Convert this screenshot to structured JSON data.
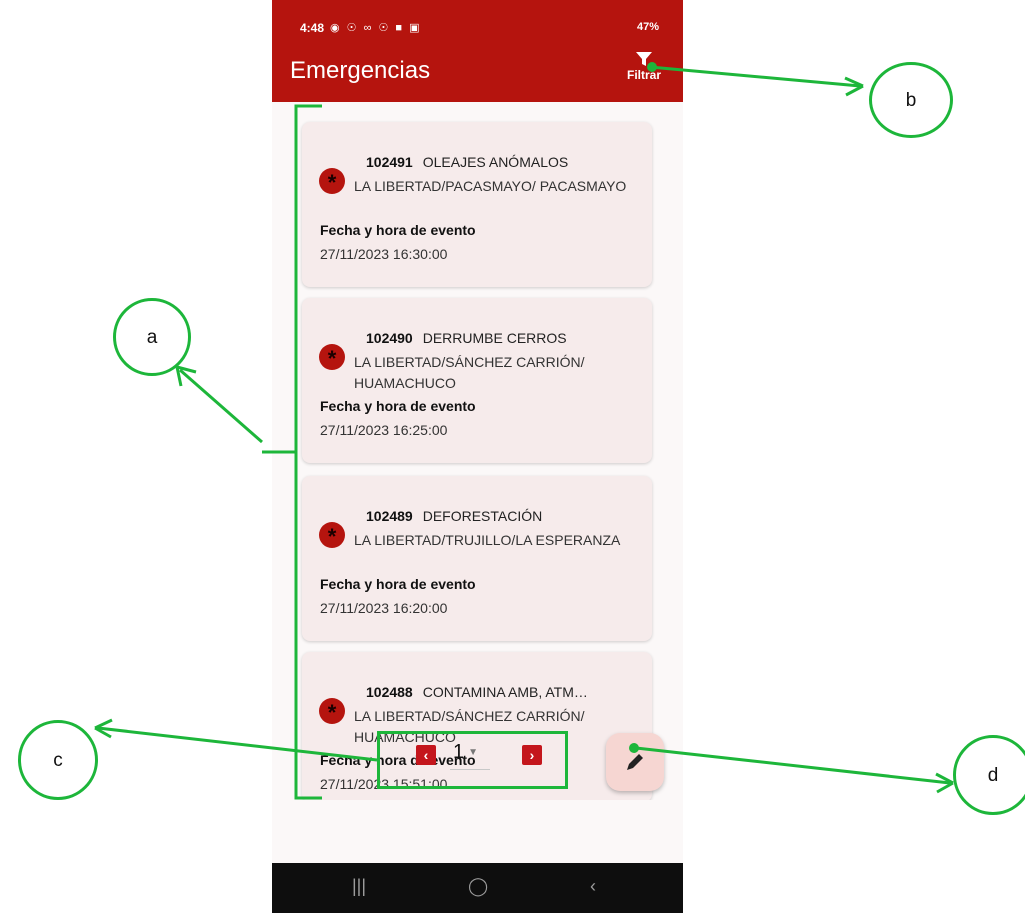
{
  "status_bar": {
    "time": "4:48",
    "left_icons": "◉ ☉ ∞ ☉ ■ ▣",
    "right_icons": "47%"
  },
  "app_bar": {
    "title": "Emergencias",
    "filter_label": "Filtrar",
    "filter_icon": "filter-icon"
  },
  "emergencies": [
    {
      "id": "102491",
      "type": "OLEAJES ANÓMALOS",
      "location": "LA LIBERTAD/PACASMAYO/ PACASMAYO",
      "date_label": "Fecha y hora de evento",
      "datetime": "27/11/2023 16:30:00"
    },
    {
      "id": "102490",
      "type": "DERRUMBE CERROS",
      "location": "LA LIBERTAD/SÁNCHEZ CARRIÓN/ HUAMACHUCO",
      "date_label": "Fecha y hora de evento",
      "datetime": "27/11/2023 16:25:00"
    },
    {
      "id": "102489",
      "type": "DEFORESTACIÓN",
      "location": "LA LIBERTAD/TRUJILLO/LA ESPERANZA",
      "date_label": "Fecha y hora de evento",
      "datetime": "27/11/2023 16:20:00"
    },
    {
      "id": "102488",
      "type": "CONTAMINA AMB, ATM…",
      "location": "LA LIBERTAD/SÁNCHEZ CARRIÓN/ HUAMACHUCO",
      "date_label": "Fecha y hora de evento",
      "datetime": "27/11/2023 15:51:00"
    }
  ],
  "pagination": {
    "prev": "‹",
    "current_page": "1",
    "next": "›"
  },
  "fab": {
    "icon": "pencil-icon"
  },
  "nav_bar": {
    "recents": "|||",
    "home": "◯",
    "back": "‹"
  },
  "annotations": {
    "a": "a",
    "b": "b",
    "c": "c",
    "d": "d"
  },
  "colors": {
    "primary": "#b5140e",
    "card_bg": "#f6ebeb",
    "annotation": "#1db63a"
  }
}
